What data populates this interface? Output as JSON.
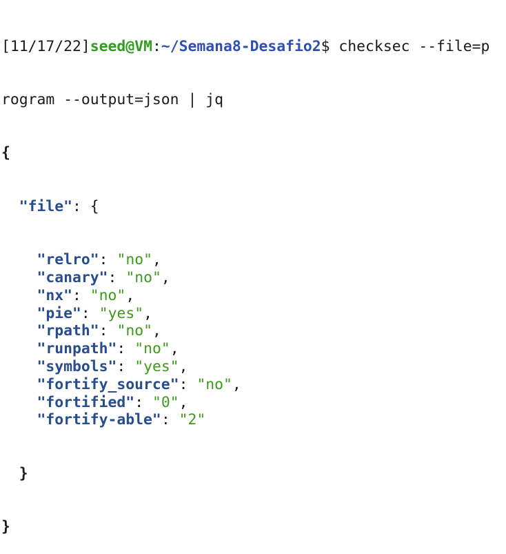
{
  "terminal": {
    "prompt_prefix": "[11/17/22]",
    "user_host": "seed@VM",
    "colon": ":",
    "path": "~/Semana8-Desafio2",
    "prompt_symbol": "$ ",
    "command_line1": "checksec --file=p",
    "command_line2": "rogram --output=json | jq"
  },
  "json_output": {
    "open_brace": "{",
    "file_key": "\"file\"",
    "file_open": ": {",
    "entries": [
      {
        "key": "\"relro\"",
        "sep": ": ",
        "value": "\"no\"",
        "tail": ","
      },
      {
        "key": "\"canary\"",
        "sep": ": ",
        "value": "\"no\"",
        "tail": ","
      },
      {
        "key": "\"nx\"",
        "sep": ": ",
        "value": "\"no\"",
        "tail": ","
      },
      {
        "key": "\"pie\"",
        "sep": ": ",
        "value": "\"yes\"",
        "tail": ","
      },
      {
        "key": "\"rpath\"",
        "sep": ": ",
        "value": "\"no\"",
        "tail": ","
      },
      {
        "key": "\"runpath\"",
        "sep": ": ",
        "value": "\"no\"",
        "tail": ","
      },
      {
        "key": "\"symbols\"",
        "sep": ": ",
        "value": "\"yes\"",
        "tail": ","
      },
      {
        "key": "\"fortify_source\"",
        "sep": ": ",
        "value": "\"no\"",
        "tail": ","
      },
      {
        "key": "\"fortified\"",
        "sep": ": ",
        "value": "\"0\"",
        "tail": ","
      },
      {
        "key": "\"fortify-able\"",
        "sep": ": ",
        "value": "\"2\"",
        "tail": ""
      }
    ],
    "inner_close": "}",
    "outer_close": "}"
  },
  "colors": {
    "background": "#ffffff",
    "text": "#1a1a1a",
    "user_host": "#2e9e1b",
    "path": "#2f4fb5",
    "json_key": "#284d8f",
    "json_string": "#3c9a1a"
  }
}
